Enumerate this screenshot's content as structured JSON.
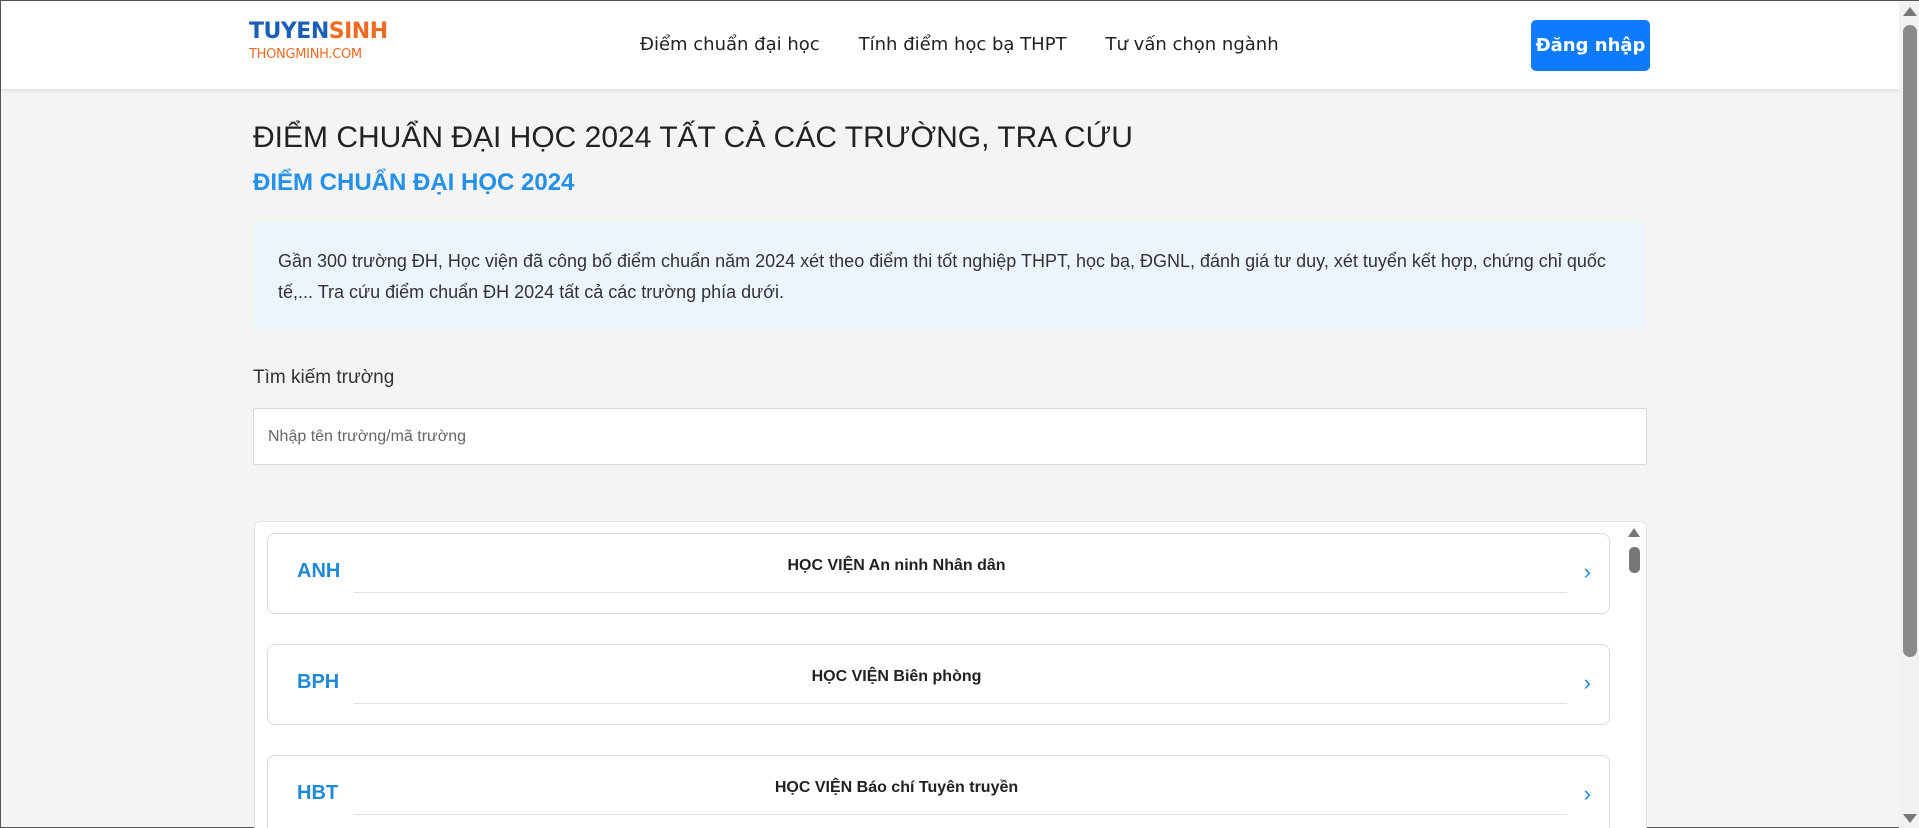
{
  "header": {
    "logo_top_a": "TUYEN",
    "logo_top_b": "SINH",
    "logo_bottom": "THONGMINH.COM",
    "nav": [
      {
        "label": "Điểm chuẩn đại học"
      },
      {
        "label": "Tính điểm học bạ THPT"
      },
      {
        "label": "Tư vấn chọn ngành"
      }
    ],
    "login_label": "Đăng nhập"
  },
  "main": {
    "title": "ĐIỂM CHUẨN ĐẠI HỌC 2024 TẤT CẢ CÁC TRƯỜNG, TRA CỨU",
    "subtitle": "ĐIỂM CHUẨN ĐẠI HỌC 2024",
    "notice": "Gần 300 trường ĐH, Học viện đã công bố điểm chuẩn năm 2024 xét theo điểm thi tốt nghiệp THPT, học bạ, ĐGNL, đánh giá tư duy, xét tuyển kết hợp, chứng chỉ quốc tế,... Tra cứu điểm chuẩn ĐH 2024 tất cả các trường phía dưới.",
    "search": {
      "label": "Tìm kiếm trường",
      "placeholder": "Nhập tên trường/mã trường",
      "value": ""
    },
    "schools": [
      {
        "code": "ANH",
        "name": "HỌC VIỆN An ninh Nhân dân"
      },
      {
        "code": "BPH",
        "name": "HỌC VIỆN Biên phòng"
      },
      {
        "code": "HBT",
        "name": "HỌC VIỆN Báo chí Tuyên truyền"
      }
    ]
  },
  "colors": {
    "primary_blue": "#0d7bff",
    "link_blue": "#2490e8",
    "logo_blue": "#1b5fb5",
    "logo_orange": "#ef6b22",
    "notice_bg": "#ecf5fd",
    "page_bg": "#f4f4f4"
  },
  "icons": {
    "chevron": "chevron-right-icon",
    "scroll_up": "scroll-up-arrow-icon",
    "scroll_down": "scroll-down-arrow-icon"
  }
}
